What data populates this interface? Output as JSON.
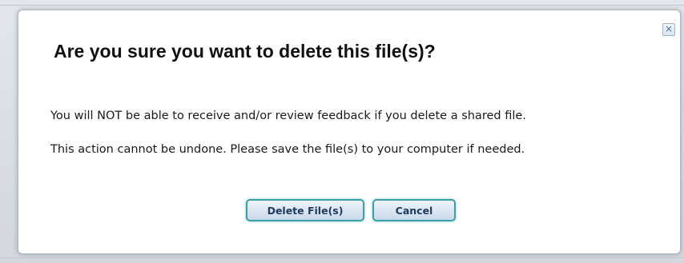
{
  "dialog": {
    "title": "Are you sure you want to delete this file(s)?",
    "close_label": "×",
    "messages": [
      "You will NOT be able to receive and/or review feedback if you delete a shared file.",
      "This action cannot be undone. Please save the file(s) to your computer if needed."
    ],
    "buttons": {
      "delete_label": "Delete File(s)",
      "cancel_label": "Cancel"
    }
  },
  "colors": {
    "button_border": "#3aa0a6",
    "button_text": "#1d3a5e",
    "close_icon": "#4f6f95"
  },
  "icons": {
    "close": "close-icon"
  }
}
